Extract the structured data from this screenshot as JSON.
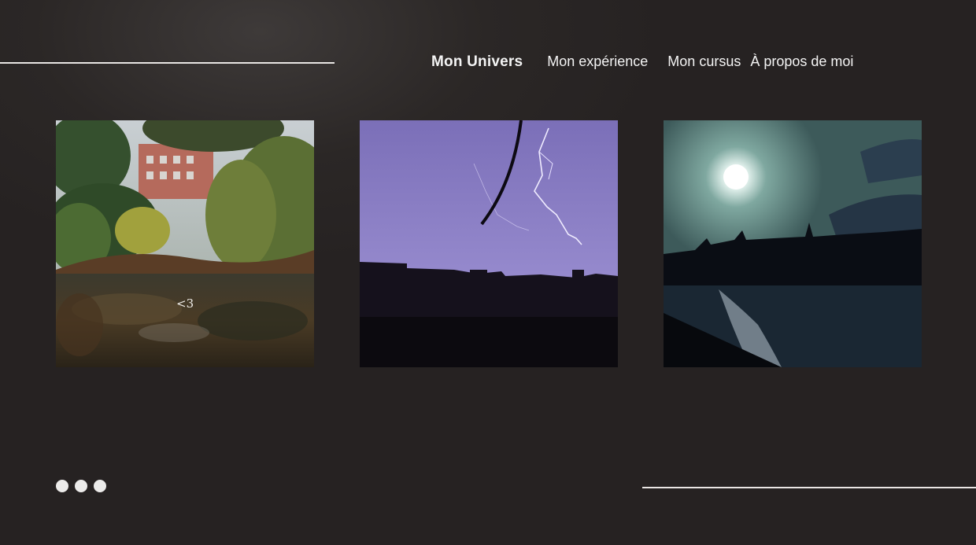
{
  "nav": {
    "items": [
      {
        "label": "Mon Univers",
        "active": true
      },
      {
        "label": "Mon expérience",
        "active": false
      },
      {
        "label": "Mon cursus",
        "active": false
      },
      {
        "label": "À propos de moi",
        "active": false
      }
    ]
  },
  "gallery": {
    "photos": [
      {
        "subject": "pond-garden",
        "caption": "<3"
      },
      {
        "subject": "lightning-sky"
      },
      {
        "subject": "sun-over-river"
      }
    ]
  },
  "pager": {
    "dot_count": 3
  },
  "colors": {
    "background": "#262222",
    "line": "#e9e6e4",
    "text": "#f4f4f4"
  }
}
